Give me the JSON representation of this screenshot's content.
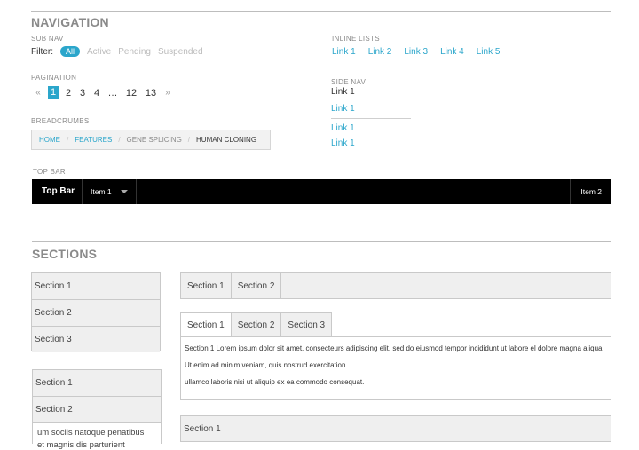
{
  "navigation": {
    "heading": "NAVIGATION",
    "sub_nav": {
      "caption": "SUB NAV",
      "filter_label": "Filter:",
      "items": [
        "All",
        "Active",
        "Pending",
        "Suspended"
      ],
      "selected": "All"
    },
    "pagination": {
      "caption": "PAGINATION",
      "prev": "«",
      "pages": [
        "1",
        "2",
        "3",
        "4",
        "…",
        "12",
        "13"
      ],
      "current": "1",
      "next": "»"
    },
    "breadcrumbs": {
      "caption": "BREADCRUMBS",
      "items": [
        "HOME",
        "FEATURES",
        "GENE SPLICING",
        "HUMAN CLONING"
      ],
      "separator": "/"
    },
    "inline_lists": {
      "caption": "INLINE LISTS",
      "items": [
        "Link 1",
        "Link 2",
        "Link 3",
        "Link 4",
        "Link 5"
      ]
    },
    "side_nav": {
      "caption": "SIDE NAV",
      "items": [
        "Link 1",
        "Link 1",
        "Link 1",
        "Link 1"
      ],
      "active_index": 0
    },
    "top_bar": {
      "caption": "TOP BAR",
      "brand": "Top Bar",
      "item1": "Item 1",
      "item2": "Item 2"
    }
  },
  "sections": {
    "heading": "SECTIONS",
    "vertical_accordion": [
      "Section 1",
      "Section 2",
      "Section 3"
    ],
    "horizontal_tabs": [
      "Section 1",
      "Section 2"
    ],
    "tabs": [
      "Section 1",
      "Section 2",
      "Section 3"
    ],
    "active_tab": "Section 1",
    "tab_content": [
      "Section 1 Lorem ipsum dolor sit amet, consecteurs adipiscing elit, sed do eiusmod tempor incididunt ut labore el dolore magna aliqua.",
      "Ut enim ad minim veniam, quis nostrud exercitation",
      "ullamco laboris nisi ut aliquip ex ea commodo consequat."
    ],
    "accordion_2": [
      "Section 1",
      "Section 2"
    ],
    "accordion_2_text": [
      "um sociis natoque penatibus",
      "et magnis dis parturient"
    ],
    "bottom_panel": "Section 1"
  },
  "colors": {
    "accent": "#2ba6cb",
    "topbar_bg": "#000000",
    "panel_bg": "#efefef"
  }
}
